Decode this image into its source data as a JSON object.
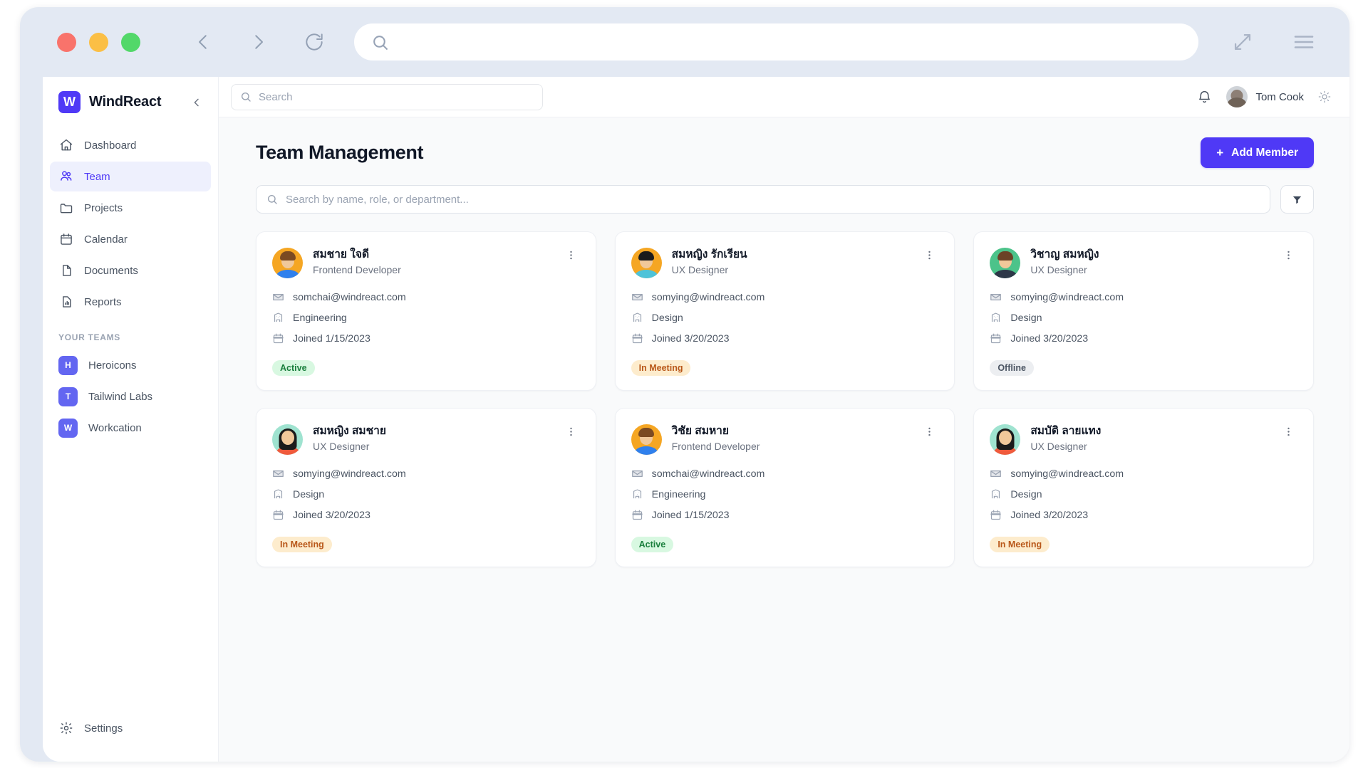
{
  "browser": {
    "url_placeholder": "",
    "search_icon": "search-icon",
    "back_icon": "chevron-left-icon",
    "forward_icon": "chevron-right-icon",
    "reload_icon": "reload-icon",
    "expand_icon": "expand-diagonal-icon",
    "menu_icon": "hamburger-menu-icon"
  },
  "sidebar": {
    "brand": {
      "logo_letter": "W",
      "name": "WindReact"
    },
    "collapse_icon": "chevron-left-icon",
    "nav": [
      {
        "label": "Dashboard",
        "icon": "home-icon",
        "active": false
      },
      {
        "label": "Team",
        "icon": "users-icon",
        "active": true
      },
      {
        "label": "Projects",
        "icon": "folder-icon",
        "active": false
      },
      {
        "label": "Calendar",
        "icon": "calendar-icon",
        "active": false
      },
      {
        "label": "Documents",
        "icon": "document-icon",
        "active": false
      },
      {
        "label": "Reports",
        "icon": "chart-document-icon",
        "active": false
      }
    ],
    "teams_label": "YOUR TEAMS",
    "teams": [
      {
        "initial": "H",
        "label": "Heroicons",
        "color": "#6366f1"
      },
      {
        "initial": "T",
        "label": "Tailwind Labs",
        "color": "#6366f1"
      },
      {
        "initial": "W",
        "label": "Workcation",
        "color": "#6366f1"
      }
    ],
    "settings": {
      "label": "Settings",
      "icon": "gear-icon"
    }
  },
  "topbar": {
    "search_placeholder": "Search",
    "notifications_icon": "bell-icon",
    "user_name": "Tom Cook",
    "theme_icon": "sun-icon"
  },
  "page": {
    "title": "Team Management",
    "add_member_label": "Add Member",
    "add_member_plus": "+",
    "search_placeholder": "Search by name, role, or department...",
    "filter_icon": "funnel-icon"
  },
  "accent": {
    "primary": "#4f39f6",
    "active_badge_bg": "#d8f8e1",
    "active_badge_fg": "#1a7f3d",
    "meeting_badge_bg": "#fdeccd",
    "meeting_badge_fg": "#b9581a",
    "offline_badge_bg": "#eceef1",
    "offline_badge_fg": "#4b5563"
  },
  "members": [
    {
      "name": "สมชาย ใจดี",
      "role": "Frontend Developer",
      "email": "somchai@windreact.com",
      "department": "Engineering",
      "joined": "Joined 1/15/2023",
      "status": "Active",
      "status_type": "active",
      "avatar": {
        "bg": "#f5a623",
        "hair": "#7b4a22",
        "skin": "#f0c89a",
        "body": "#2f80ed",
        "style": "short"
      }
    },
    {
      "name": "สมหญิง รักเรียน",
      "role": "UX Designer",
      "email": "somying@windreact.com",
      "department": "Design",
      "joined": "Joined 3/20/2023",
      "status": "In Meeting",
      "status_type": "meeting",
      "avatar": {
        "bg": "#f5a623",
        "hair": "#1b1b1b",
        "skin": "#f0c89a",
        "body": "#4ec3d9",
        "style": "short"
      }
    },
    {
      "name": "วิชาญ สมหญิง",
      "role": "UX Designer",
      "email": "somying@windreact.com",
      "department": "Design",
      "joined": "Joined 3/20/2023",
      "status": "Offline",
      "status_type": "offline",
      "avatar": {
        "bg": "#4cc38a",
        "hair": "#6b4226",
        "skin": "#f0c89a",
        "body": "#2d3748",
        "style": "short"
      }
    },
    {
      "name": "สมหญิง สมชาย",
      "role": "UX Designer",
      "email": "somying@windreact.com",
      "department": "Design",
      "joined": "Joined 3/20/2023",
      "status": "In Meeting",
      "status_type": "meeting",
      "avatar": {
        "bg": "#9fe3d0",
        "hair": "#1b1b1b",
        "skin": "#f0c89a",
        "body": "#f05a3c",
        "style": "long"
      }
    },
    {
      "name": "วิชัย สมหาย",
      "role": "Frontend Developer",
      "email": "somchai@windreact.com",
      "department": "Engineering",
      "joined": "Joined 1/15/2023",
      "status": "Active",
      "status_type": "active",
      "avatar": {
        "bg": "#f5a623",
        "hair": "#7b4a22",
        "skin": "#f0c89a",
        "body": "#2f80ed",
        "style": "short"
      }
    },
    {
      "name": "สมบัติ ลายแทง",
      "role": "UX Designer",
      "email": "somying@windreact.com",
      "department": "Design",
      "joined": "Joined 3/20/2023",
      "status": "In Meeting",
      "status_type": "meeting",
      "avatar": {
        "bg": "#9fe3d0",
        "hair": "#1b1b1b",
        "skin": "#f0c89a",
        "body": "#f05a3c",
        "style": "long"
      }
    }
  ],
  "icons": {
    "email": "envelope-icon",
    "department": "building-icon",
    "joined": "calendar-icon",
    "kebab": "more-vertical-icon"
  }
}
